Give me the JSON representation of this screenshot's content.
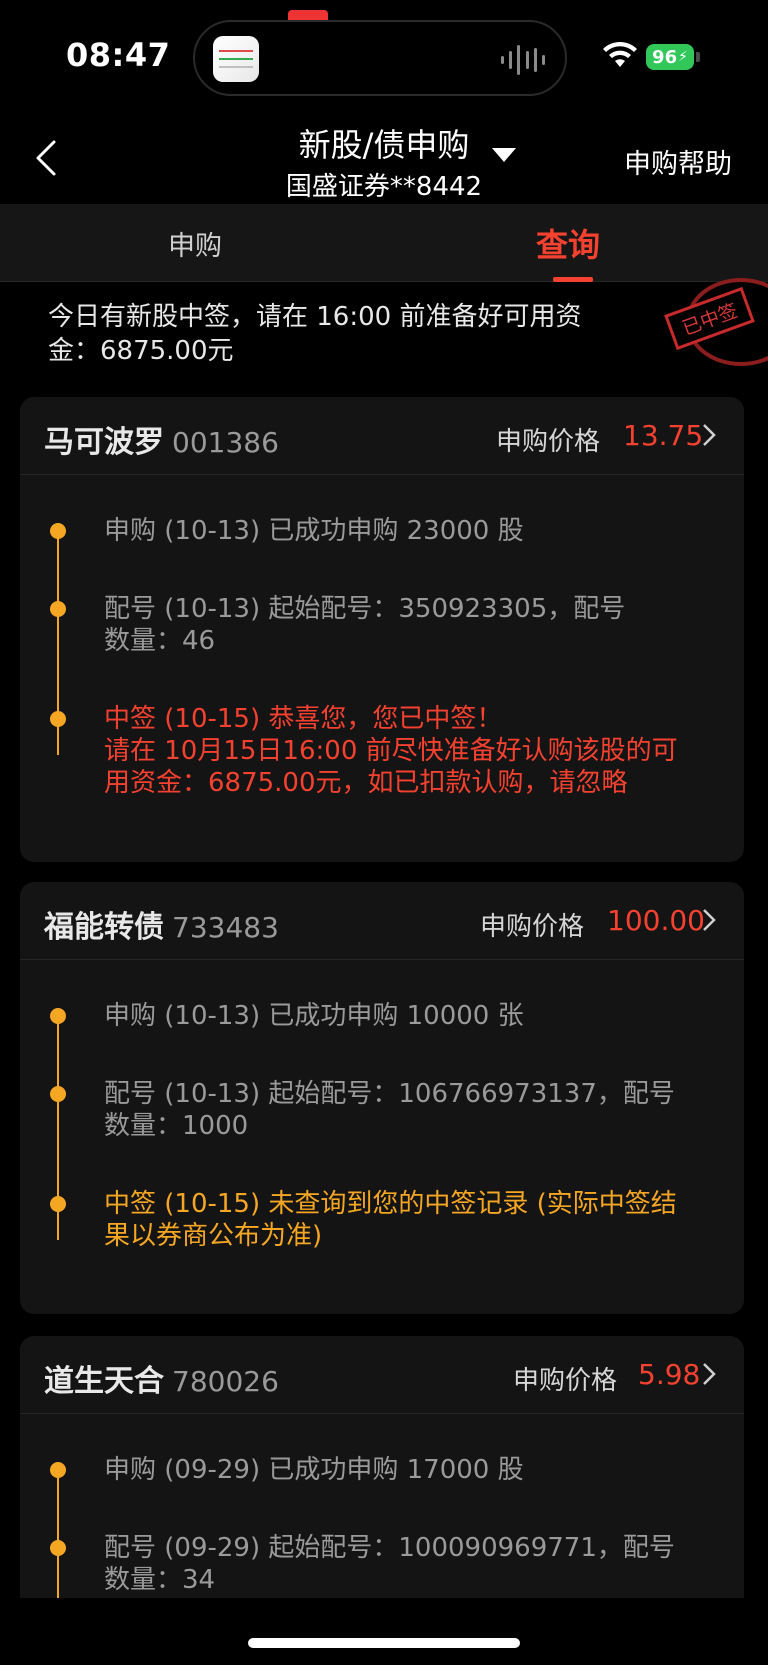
{
  "status_bar": {
    "time": "08:47",
    "battery": "96"
  },
  "nav": {
    "title": "新股/债申购",
    "subtitle": "国盛证券**8442",
    "help": "申购帮助"
  },
  "tabs": [
    {
      "label": "申购",
      "active": false
    },
    {
      "label": "查询",
      "active": true
    }
  ],
  "notice": {
    "text": "今日有新股中签，请在 16:00 前准备好可用资金：6875.00元",
    "stamp": "已中签"
  },
  "price_label": "申购价格",
  "cards": [
    {
      "name": "马可波罗",
      "code": "001386",
      "price": "13.75",
      "items": [
        {
          "lines": [
            "申购 (10-13) 已成功申购 23000 股"
          ],
          "style": "normal"
        },
        {
          "lines": [
            "配号 (10-13) 起始配号：350923305，配号",
            "数量：46"
          ],
          "style": "normal"
        },
        {
          "lines": [
            "中签 (10-15) 恭喜您，您已中签！",
            "请在 10月15日16:00 前尽快准备好认购该股的可",
            "用资金：6875.00元，如已扣款认购，请忽略"
          ],
          "style": "red"
        }
      ]
    },
    {
      "name": "福能转债",
      "code": "733483",
      "price": "100.00",
      "items": [
        {
          "lines": [
            "申购 (10-13) 已成功申购 10000 张"
          ],
          "style": "normal"
        },
        {
          "lines": [
            "配号 (10-13) 起始配号：106766973137，配号",
            "数量：1000"
          ],
          "style": "normal"
        },
        {
          "lines": [
            "中签 (10-15) 未查询到您的中签记录 (实际中签结",
            "果以券商公布为准)"
          ],
          "style": "orange"
        }
      ]
    },
    {
      "name": "道生天合",
      "code": "780026",
      "price": "5.98",
      "items": [
        {
          "lines": [
            "申购 (09-29) 已成功申购 17000 股"
          ],
          "style": "normal"
        },
        {
          "lines": [
            "配号 (09-29) 起始配号：100090969771，配号",
            "数量：34"
          ],
          "style": "normal"
        }
      ]
    }
  ],
  "colors": {
    "accent": "#f5412f",
    "timeline": "#f5a623",
    "background": "#000000",
    "card": "#141414"
  }
}
